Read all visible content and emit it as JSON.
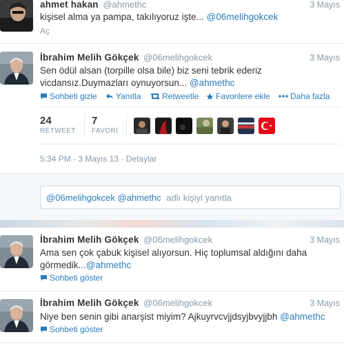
{
  "tweet1": {
    "name": "ahmet hakan",
    "handle": "@ahmethc",
    "date": "3 Mayıs",
    "text_main": "kişisel alma ya pampa, takılıyoruz işte...",
    "text_mention": "@06melihgokcek",
    "expand": "Aç"
  },
  "tweet2": {
    "name": "İbrahim Melih Gökçek",
    "handle": "@06melihgokcek",
    "date": "3 Mayıs",
    "line1": "Sen ödül alsan (torpille olsa bile) biz seni tebrik ederiz",
    "line2_main": "vicdansız.Duymazları oynuyorsun...",
    "line2_mention": "@ahmethc",
    "actions": {
      "hide": "Sohbeti gizle",
      "reply": "Yanıtla",
      "retweet": "Retweetle",
      "favorite": "Favorilere ekle",
      "more": "Daha fazla"
    },
    "retweet_count": "24",
    "retweet_label": "RETWEET",
    "favorite_count": "7",
    "favorite_label": "FAVORİ",
    "timestamp": "5:34 PM - 3 Mayıs 13",
    "details": "Detaylar"
  },
  "reply_box": {
    "mentions": "@06melihgokcek @ahmethc",
    "placeholder": "adlı kişiyi yanıtla"
  },
  "tweet3": {
    "name": "İbrahim Melih Gökçek",
    "handle": "@06melihgokcek",
    "date": "3 Mayıs",
    "line1": "Ama sen çok çabuk kişisel alıyorsun. Hiç toplumsal aldığını daha",
    "line2_main": "görmedik...",
    "line2_mention": "@ahmethc",
    "show": "Sohbeti göster"
  },
  "tweet4": {
    "name": "İbrahim Melih Gökçek",
    "handle": "@06melihgokcek",
    "date": "3 Mayıs",
    "text_main": "Niye ben senin gibi anarşist miyim? Ajkuyrvcvjjdsyjbvyjjbh",
    "text_mention": "@ahmethc",
    "show": "Sohbeti göster"
  },
  "colors": {
    "link": "#2b7bb9",
    "muted": "#8899a6",
    "text": "#333333"
  }
}
